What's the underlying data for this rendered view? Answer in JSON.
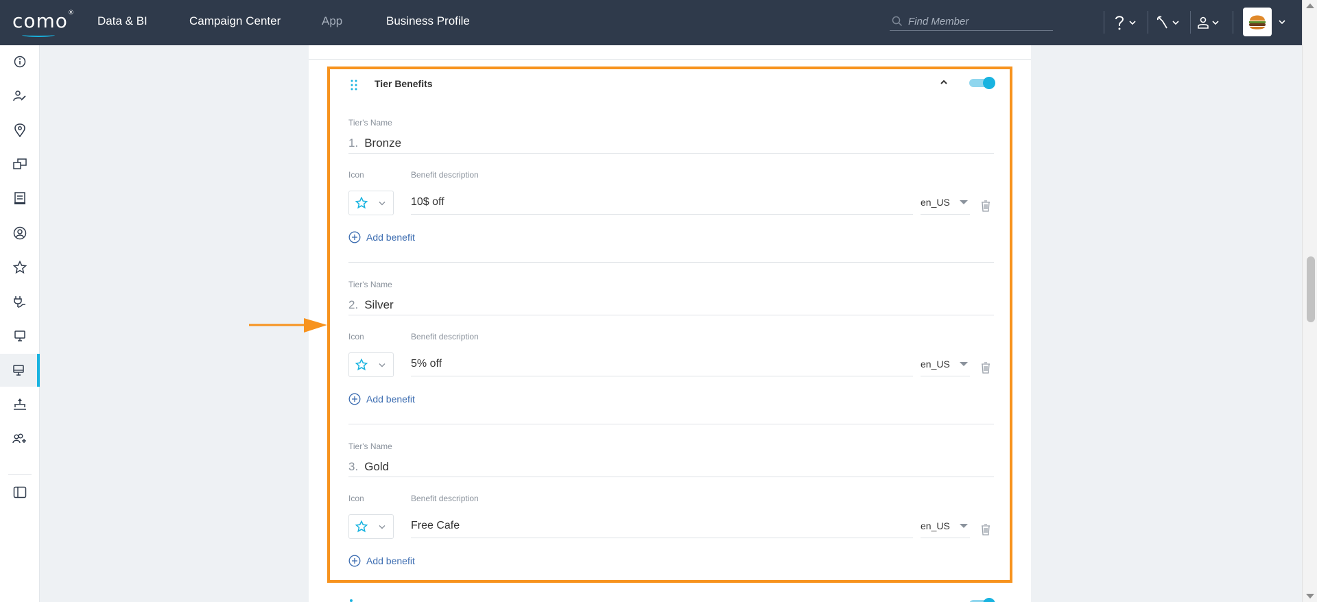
{
  "topbar": {
    "logo": "como",
    "logo_mark": "®",
    "nav": [
      {
        "label": "Data & BI",
        "state": "active"
      },
      {
        "label": "Campaign Center",
        "state": "active"
      },
      {
        "label": "App",
        "state": "dim"
      },
      {
        "label": "Business Profile",
        "state": "active"
      }
    ],
    "search_placeholder": "Find Member",
    "icons": [
      "help-icon",
      "tools-icon",
      "user-icon",
      "business-avatar"
    ]
  },
  "rail": {
    "icons": [
      "info-icon",
      "member-edit-icon",
      "location-icon",
      "campaigns-icon",
      "receipt-icon",
      "profile-icon",
      "star-icon",
      "plug-icon",
      "pos-icon",
      "pos-active-icon",
      "sitemap-icon",
      "users-add-icon",
      "panel-icon"
    ],
    "active_index": 9
  },
  "section": {
    "title": "Tier Benefits",
    "enabled": true,
    "tier_name_label": "Tier's Name",
    "icon_label": "Icon",
    "benefit_label": "Benefit description",
    "add_benefit_label": "Add benefit",
    "tiers": [
      {
        "num": "1.",
        "name": "Bronze",
        "benefit": "10$ off",
        "lang": "en_US"
      },
      {
        "num": "2.",
        "name": "Silver",
        "benefit": "5% off",
        "lang": "en_US"
      },
      {
        "num": "3.",
        "name": "Gold",
        "benefit": "Free Cafe",
        "lang": "en_US"
      }
    ]
  },
  "colors": {
    "topbar": "#2f3a4b",
    "accent": "#18b3e0",
    "highlight": "#f7931e",
    "link": "#3a6bb0"
  }
}
